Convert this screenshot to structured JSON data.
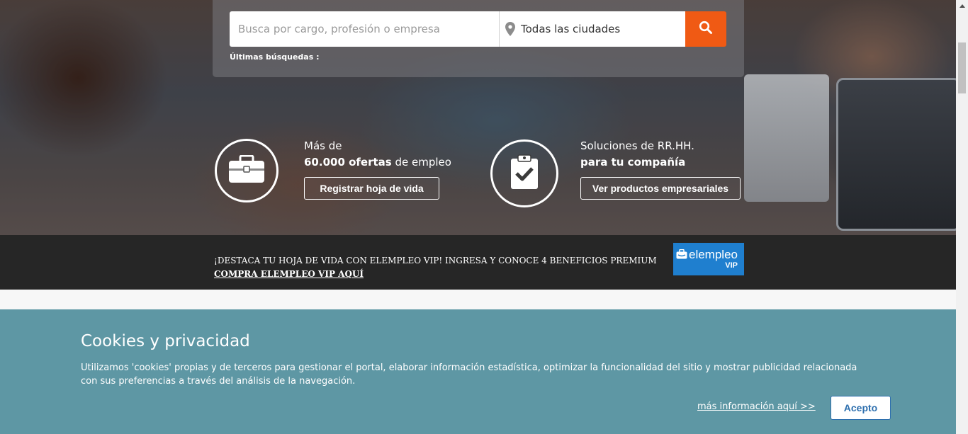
{
  "search": {
    "keyword_placeholder": "Busca por cargo, profesión o empresa",
    "city_value": "Todas las ciudades",
    "recent_label": "Últimas búsquedas :",
    "button_color": "#f05a14"
  },
  "features": [
    {
      "line1": "Más de",
      "line2_bold": "60.000 ofertas",
      "line2_rest": " de empleo",
      "button": "Registrar hoja de vida",
      "icon": "briefcase-icon"
    },
    {
      "line1": "Soluciones de RR.HH.",
      "line2_bold": "para tu compañía",
      "button": "Ver productos empresariales",
      "icon": "clipboard-check-icon"
    }
  ],
  "vip": {
    "headline": "¡DESTACA TU HOJA DE VIDA CON ELEMPLEO VIP! INGRESA Y CONOCE 4 BENEFICIOS PREMIUM",
    "link": "COMPRA ELEMPLEO VIP AQUÍ",
    "logo_text": "elempleo",
    "logo_sub": "VIP",
    "logo_color": "#1f7fcf"
  },
  "cookie": {
    "title": "Cookies y privacidad",
    "body": "Utilizamos 'cookies' propias y de terceros para gestionar el portal, elaborar información estadística, optimizar la funcionalidad del sitio y mostrar publicidad relacionada con sus preferencias a través del análisis de la navegación.",
    "more_link": "más información aquí >>",
    "accept": "Acepto",
    "background": "#5e97a4"
  }
}
